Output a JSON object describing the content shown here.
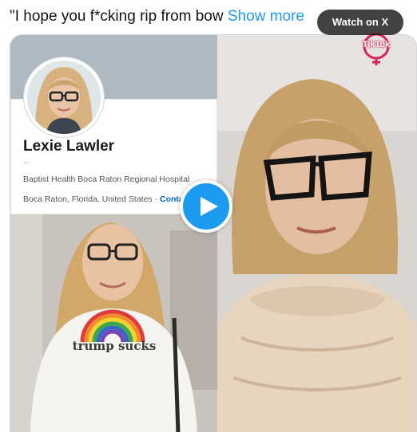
{
  "tweet": {
    "text": "\"I hope you f*cking rip from bow",
    "show_more": "Show more"
  },
  "profile_card": {
    "name": "Lexie Lawler",
    "headline": "--",
    "workplace": "Baptist Health Boca Raton Regional Hospital",
    "location": "Boca Raton, Florida, United States",
    "separator": " · ",
    "contact_link": "Contact info"
  },
  "shirt_print": "trump sucks",
  "watermark": {
    "label": "TikTok",
    "icon": "tiktok-logo-icon"
  },
  "controls": {
    "watch_on": "Watch on X",
    "play_icon": "play-icon"
  },
  "colors": {
    "link": "#1d9bf0",
    "play_button": "#1d9bf0",
    "contact_link": "#0a66c2",
    "text": "#0f1419"
  }
}
